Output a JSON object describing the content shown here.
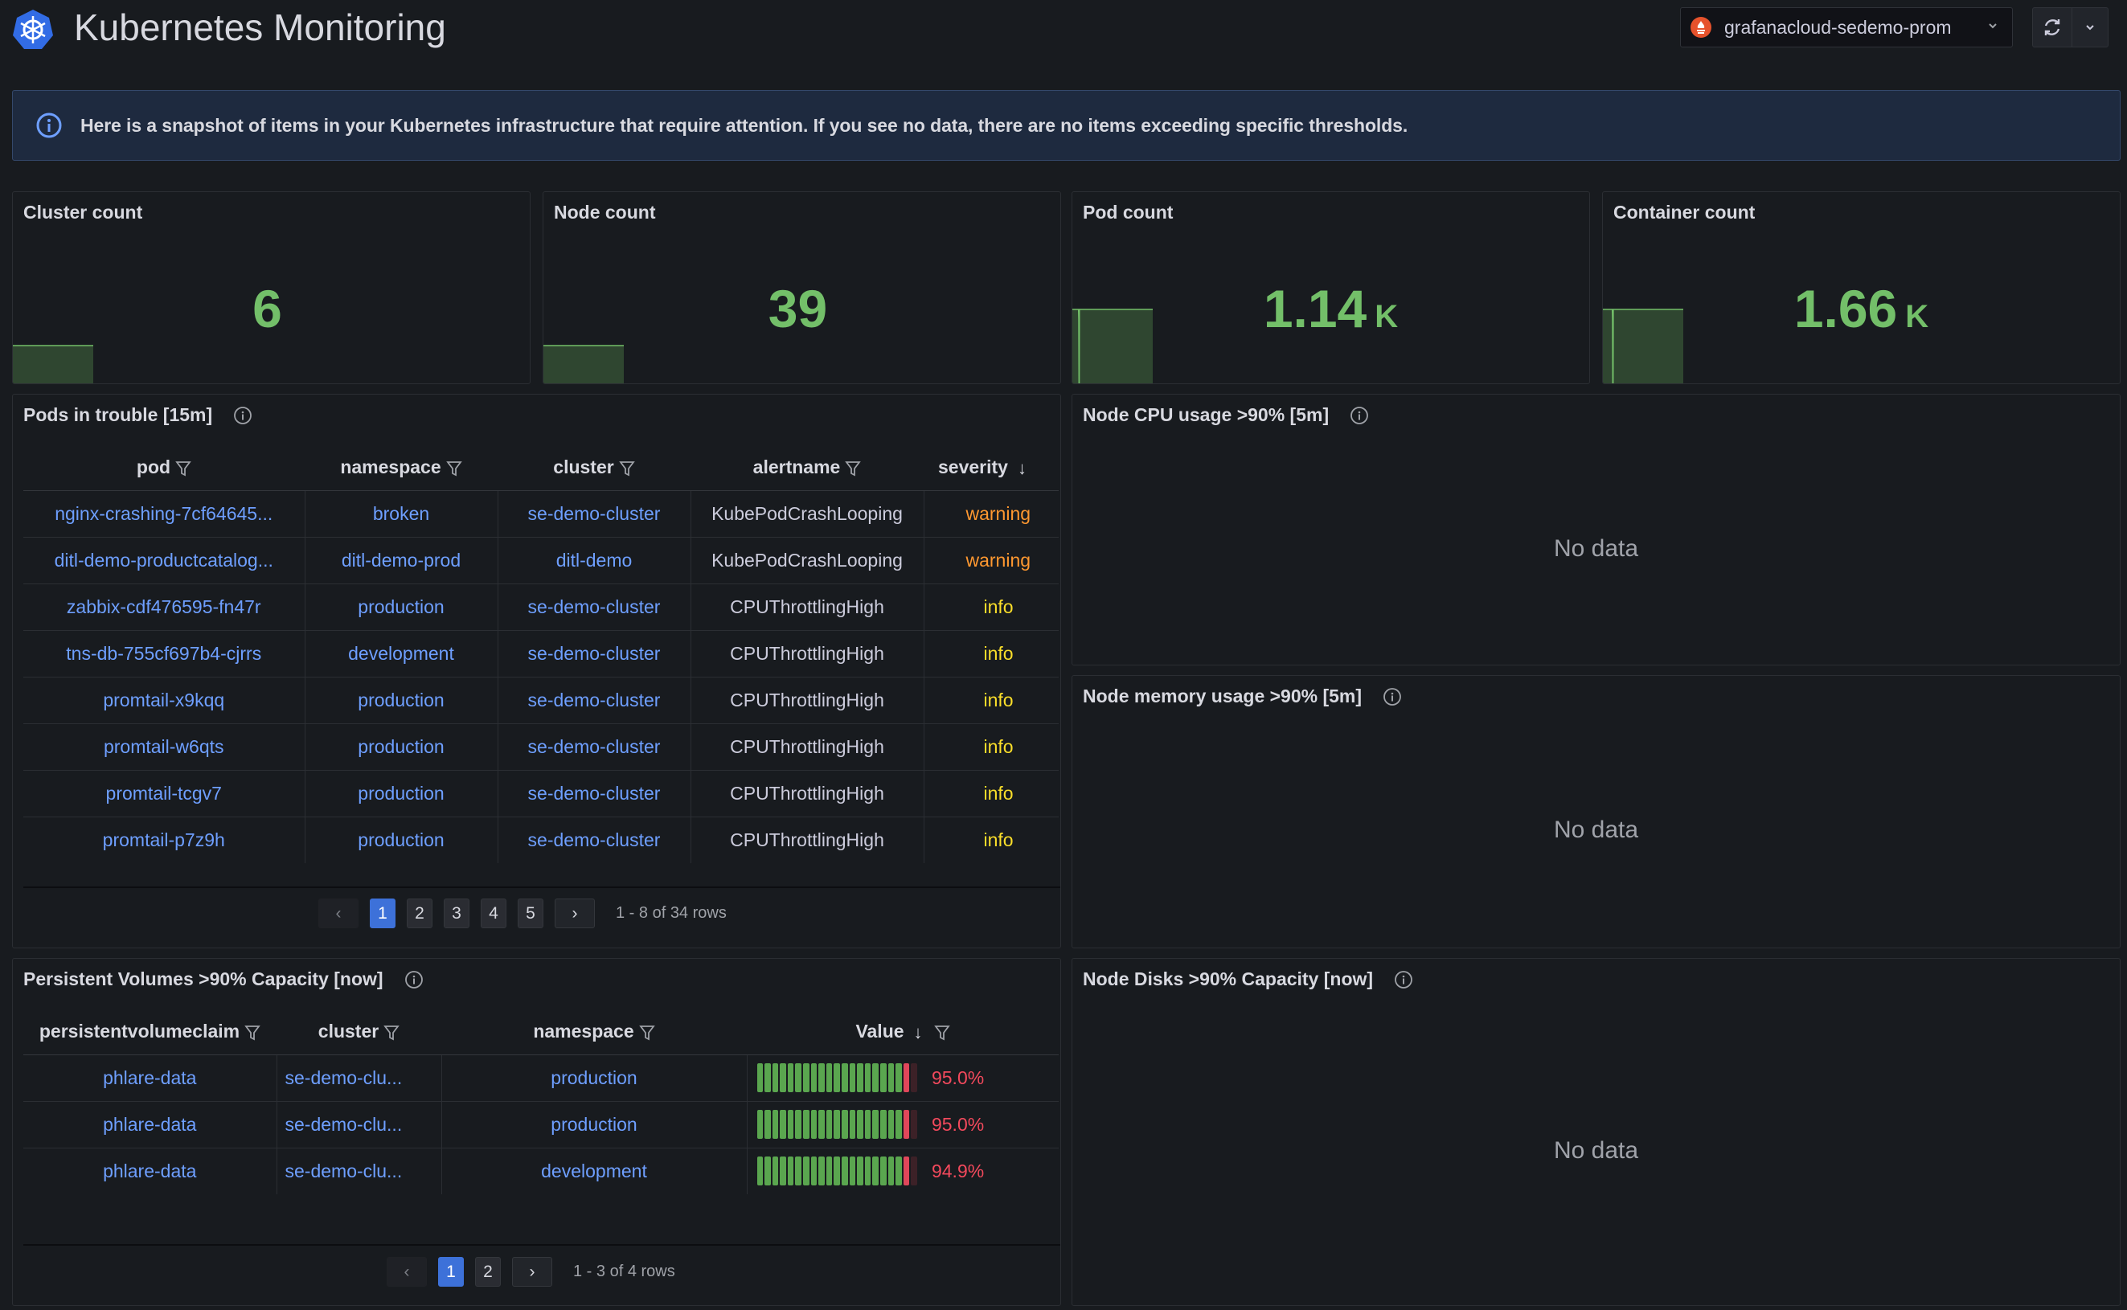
{
  "header": {
    "title": "Kubernetes Monitoring",
    "datasource": "grafanacloud-sedemo-prom"
  },
  "banner": {
    "text": "Here is a snapshot of items in your Kubernetes infrastructure that require attention. If you see no data, there are no items exceeding specific thresholds."
  },
  "stats": [
    {
      "title": "Cluster count",
      "value": "6",
      "unit": "",
      "color": "#73bf69"
    },
    {
      "title": "Node count",
      "value": "39",
      "unit": "",
      "color": "#73bf69"
    },
    {
      "title": "Pod count",
      "value": "1.14",
      "unit": "K",
      "color": "#73bf69"
    },
    {
      "title": "Container count",
      "value": "1.66",
      "unit": "K",
      "color": "#73bf69"
    }
  ],
  "pods_panel": {
    "title": "Pods in trouble [15m]",
    "columns": [
      "pod",
      "namespace",
      "cluster",
      "alertname",
      "severity"
    ],
    "rows": [
      {
        "pod": "nginx-crashing-7cf64645...",
        "namespace": "broken",
        "cluster": "se-demo-cluster",
        "alertname": "KubePodCrashLooping",
        "severity": "warning"
      },
      {
        "pod": "ditl-demo-productcatalog...",
        "namespace": "ditl-demo-prod",
        "cluster": "ditl-demo",
        "alertname": "KubePodCrashLooping",
        "severity": "warning"
      },
      {
        "pod": "zabbix-cdf476595-fn47r",
        "namespace": "production",
        "cluster": "se-demo-cluster",
        "alertname": "CPUThrottlingHigh",
        "severity": "info"
      },
      {
        "pod": "tns-db-755cf697b4-cjrrs",
        "namespace": "development",
        "cluster": "se-demo-cluster",
        "alertname": "CPUThrottlingHigh",
        "severity": "info"
      },
      {
        "pod": "promtail-x9kqq",
        "namespace": "production",
        "cluster": "se-demo-cluster",
        "alertname": "CPUThrottlingHigh",
        "severity": "info"
      },
      {
        "pod": "promtail-w6qts",
        "namespace": "production",
        "cluster": "se-demo-cluster",
        "alertname": "CPUThrottlingHigh",
        "severity": "info"
      },
      {
        "pod": "promtail-tcgv7",
        "namespace": "production",
        "cluster": "se-demo-cluster",
        "alertname": "CPUThrottlingHigh",
        "severity": "info"
      },
      {
        "pod": "promtail-p7z9h",
        "namespace": "production",
        "cluster": "se-demo-cluster",
        "alertname": "CPUThrottlingHigh",
        "severity": "info"
      }
    ],
    "pagination": {
      "pages": [
        "1",
        "2",
        "3",
        "4",
        "5"
      ],
      "current": "1",
      "summary": "1 - 8 of 34 rows"
    }
  },
  "cpu_panel": {
    "title": "Node CPU usage >90% [5m]",
    "empty_text": "No data"
  },
  "memory_panel": {
    "title": "Node memory usage >90% [5m]",
    "empty_text": "No data"
  },
  "pv_panel": {
    "title": "Persistent Volumes >90% Capacity [now]",
    "columns": [
      "persistentvolumeclaim",
      "cluster",
      "namespace",
      "Value"
    ],
    "rows": [
      {
        "pvc": "phlare-data",
        "cluster": "se-demo-clu...",
        "namespace": "production",
        "value": 0.95,
        "value_text": "95.0%"
      },
      {
        "pvc": "phlare-data",
        "cluster": "se-demo-clu...",
        "namespace": "production",
        "value": 0.95,
        "value_text": "95.0%"
      },
      {
        "pvc": "phlare-data",
        "cluster": "se-demo-clu...",
        "namespace": "development",
        "value": 0.949,
        "value_text": "94.9%"
      }
    ],
    "pagination": {
      "pages": [
        "1",
        "2"
      ],
      "current": "1",
      "summary": "1 - 3 of 4 rows"
    }
  },
  "disks_panel": {
    "title": "Node Disks >90% Capacity [now]",
    "empty_text": "No data"
  }
}
